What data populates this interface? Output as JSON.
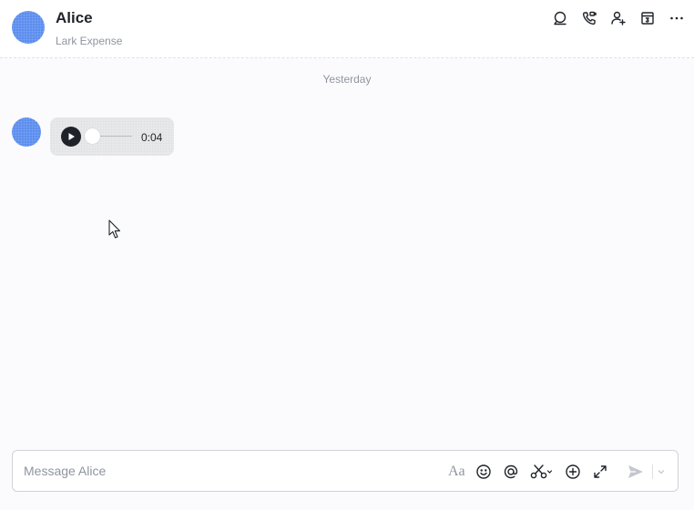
{
  "header": {
    "title": "Alice",
    "subtitle": "Lark Expense",
    "actions": [
      "search-chat-icon",
      "video-call-icon",
      "add-member-icon",
      "calendar-icon",
      "more-icon"
    ]
  },
  "messages": {
    "date_separator": "Yesterday",
    "voice": {
      "duration": "0:04",
      "progress": 0
    }
  },
  "composer": {
    "placeholder": "Message Alice",
    "format_label": "Aa",
    "tools": [
      "text-format-icon",
      "emoji-icon",
      "mention-icon",
      "screenshot-icon",
      "add-icon",
      "expand-icon",
      "send-icon",
      "send-options-icon"
    ]
  },
  "colors": {
    "avatar": "#5b8def",
    "text_primary": "#1f2329",
    "text_secondary": "#8f959e",
    "bubble": "#e8e9eb",
    "background": "#fbfbfe"
  }
}
